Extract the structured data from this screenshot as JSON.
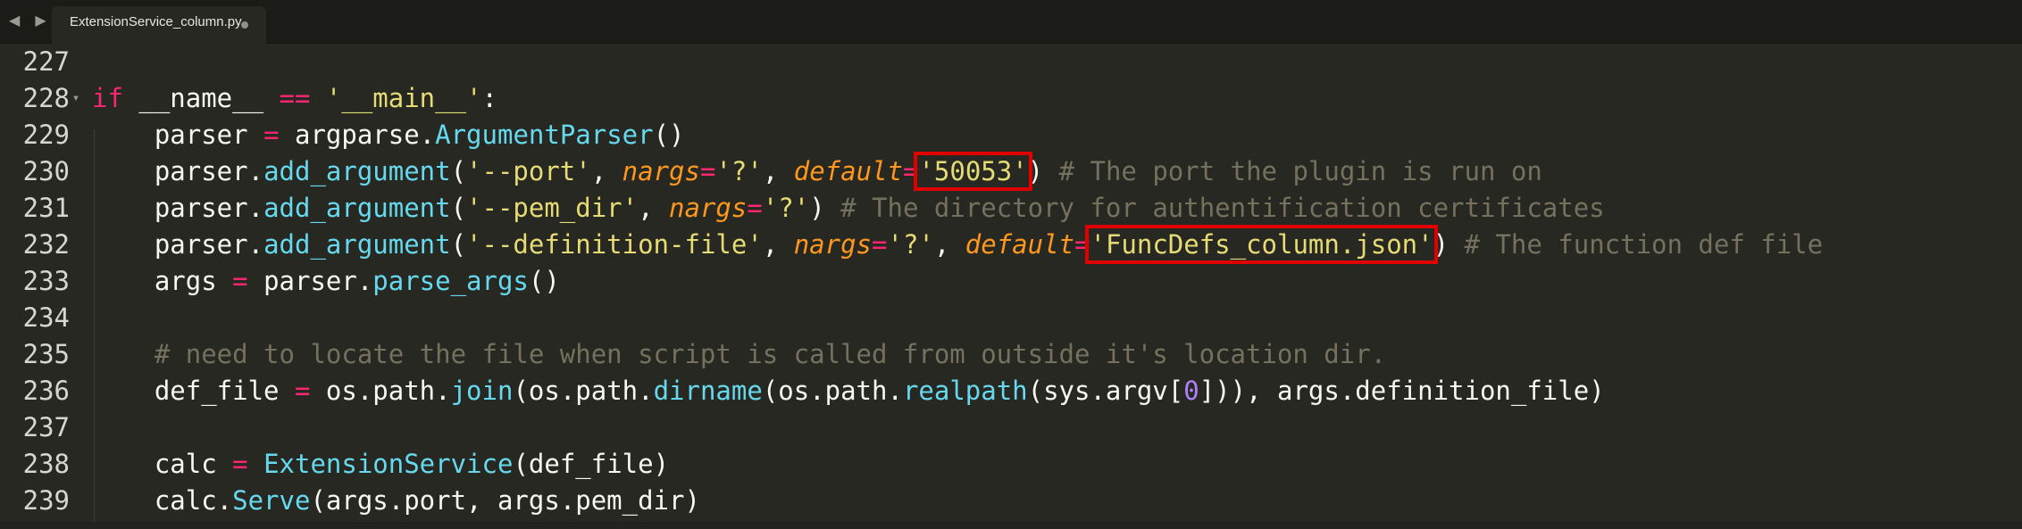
{
  "window": {
    "tab_title": "ExtensionService_column.py",
    "nav_arrows": "◀ ▶"
  },
  "editor": {
    "lines": [
      {
        "num": "227",
        "fold": "",
        "tokens": []
      },
      {
        "num": "228",
        "fold": "▾",
        "tokens": [
          {
            "t": "if",
            "c": "kw"
          },
          {
            "t": " __name__ "
          },
          {
            "t": "==",
            "c": "op"
          },
          {
            "t": " "
          },
          {
            "t": "'__main__'",
            "c": "str"
          },
          {
            "t": ":"
          }
        ]
      },
      {
        "num": "229",
        "fold": "",
        "tokens": [
          {
            "t": "    parser "
          },
          {
            "t": "=",
            "c": "op"
          },
          {
            "t": " argparse."
          },
          {
            "t": "ArgumentParser",
            "c": "fn"
          },
          {
            "t": "()"
          }
        ]
      },
      {
        "num": "230",
        "fold": "",
        "tokens": [
          {
            "t": "    parser."
          },
          {
            "t": "add_argument",
            "c": "fn"
          },
          {
            "t": "("
          },
          {
            "t": "'--port'",
            "c": "str"
          },
          {
            "t": ", "
          },
          {
            "t": "nargs",
            "c": "param"
          },
          {
            "t": "=",
            "c": "op"
          },
          {
            "t": "'?'",
            "c": "str"
          },
          {
            "t": ", "
          },
          {
            "t": "default",
            "c": "param"
          },
          {
            "t": "=",
            "c": "op"
          },
          {
            "t": "'50053'",
            "c": "str",
            "hl": true
          },
          {
            "t": ") "
          },
          {
            "t": "# The port the plugin is run on",
            "c": "cm"
          }
        ]
      },
      {
        "num": "231",
        "fold": "",
        "tokens": [
          {
            "t": "    parser."
          },
          {
            "t": "add_argument",
            "c": "fn"
          },
          {
            "t": "("
          },
          {
            "t": "'--pem_dir'",
            "c": "str"
          },
          {
            "t": ", "
          },
          {
            "t": "nargs",
            "c": "param"
          },
          {
            "t": "=",
            "c": "op"
          },
          {
            "t": "'?'",
            "c": "str"
          },
          {
            "t": ") "
          },
          {
            "t": "# The directory for authentification certificates",
            "c": "cm"
          }
        ]
      },
      {
        "num": "232",
        "fold": "",
        "tokens": [
          {
            "t": "    parser."
          },
          {
            "t": "add_argument",
            "c": "fn"
          },
          {
            "t": "("
          },
          {
            "t": "'--definition-file'",
            "c": "str"
          },
          {
            "t": ", "
          },
          {
            "t": "nargs",
            "c": "param"
          },
          {
            "t": "=",
            "c": "op"
          },
          {
            "t": "'?'",
            "c": "str"
          },
          {
            "t": ", "
          },
          {
            "t": "default",
            "c": "param"
          },
          {
            "t": "=",
            "c": "op"
          },
          {
            "t": "'FuncDefs_column.json'",
            "c": "str",
            "hl": true
          },
          {
            "t": ") "
          },
          {
            "t": "# The function def file",
            "c": "cm"
          }
        ]
      },
      {
        "num": "233",
        "fold": "",
        "tokens": [
          {
            "t": "    args "
          },
          {
            "t": "=",
            "c": "op"
          },
          {
            "t": " parser."
          },
          {
            "t": "parse_args",
            "c": "fn"
          },
          {
            "t": "()"
          }
        ]
      },
      {
        "num": "234",
        "fold": "",
        "tokens": []
      },
      {
        "num": "235",
        "fold": "",
        "tokens": [
          {
            "t": "    "
          },
          {
            "t": "# need to locate the file when script is called from outside it's location dir.",
            "c": "cm"
          }
        ]
      },
      {
        "num": "236",
        "fold": "",
        "tokens": [
          {
            "t": "    def_file "
          },
          {
            "t": "=",
            "c": "op"
          },
          {
            "t": " os.path."
          },
          {
            "t": "join",
            "c": "fn"
          },
          {
            "t": "(os.path."
          },
          {
            "t": "dirname",
            "c": "fn"
          },
          {
            "t": "(os.path."
          },
          {
            "t": "realpath",
            "c": "fn"
          },
          {
            "t": "(sys.argv["
          },
          {
            "t": "0",
            "c": "num"
          },
          {
            "t": "])), args.definition_file)"
          }
        ]
      },
      {
        "num": "237",
        "fold": "",
        "tokens": []
      },
      {
        "num": "238",
        "fold": "",
        "tokens": [
          {
            "t": "    calc "
          },
          {
            "t": "=",
            "c": "op"
          },
          {
            "t": " "
          },
          {
            "t": "ExtensionService",
            "c": "fn"
          },
          {
            "t": "(def_file)"
          }
        ]
      },
      {
        "num": "239",
        "fold": "",
        "tokens": [
          {
            "t": "    calc."
          },
          {
            "t": "Serve",
            "c": "fn"
          },
          {
            "t": "(args.port, args.pem_dir)"
          }
        ]
      }
    ]
  },
  "colors": {
    "background": "#272822",
    "keyword": "#f92672",
    "string": "#e6db74",
    "function": "#66d9ef",
    "parameter": "#fd971f",
    "number": "#ae81ff",
    "comment": "#75715e",
    "highlight_box": "#e00000"
  }
}
